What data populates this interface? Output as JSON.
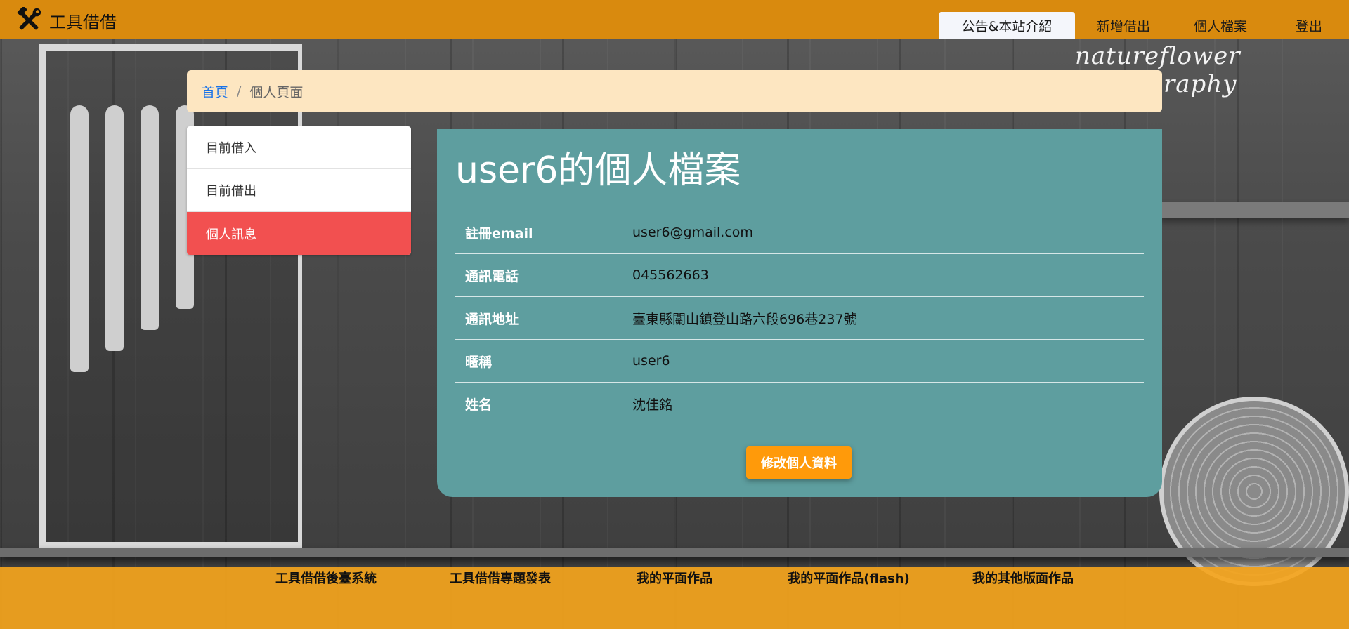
{
  "brand": {
    "name": "工具借借",
    "icon": "tools-icon"
  },
  "nav": {
    "items": [
      {
        "label": "公告&本站介紹",
        "active": true
      },
      {
        "label": "新增借出"
      },
      {
        "label": "個人檔案"
      },
      {
        "label": "登出"
      }
    ]
  },
  "breadcrumb": {
    "home": "首頁",
    "separator": "/",
    "current": "個人頁面"
  },
  "side_menu": {
    "items": [
      {
        "label": "目前借入"
      },
      {
        "label": "目前借出"
      },
      {
        "label": "個人訊息",
        "active": true
      }
    ]
  },
  "profile": {
    "title": "user6的個人檔案",
    "rows": [
      {
        "label": "註冊email",
        "value": "user6@gmail.com"
      },
      {
        "label": "通訊電話",
        "value": "045562663"
      },
      {
        "label": "通訊地址",
        "value": "臺東縣關山鎮登山路六段696巷237號"
      },
      {
        "label": "暱稱",
        "value": "user6"
      },
      {
        "label": "姓名",
        "value": "沈佳銘"
      }
    ],
    "edit_button": "修改個人資料"
  },
  "footer": {
    "links": [
      "工具借借後臺系統",
      "工具借借專題發表",
      "我的平面作品",
      "我的平面作品(flash)",
      "我的其他版面作品"
    ]
  },
  "watermark": "natureflower photography",
  "colors": {
    "navbar": "#d98a0e",
    "breadcrumb_bg": "#fde6c1",
    "card_bg": "#5e9e9f",
    "active_menu": "#f25050",
    "button": "#ff9a0a",
    "footer": "#f4a41c"
  }
}
